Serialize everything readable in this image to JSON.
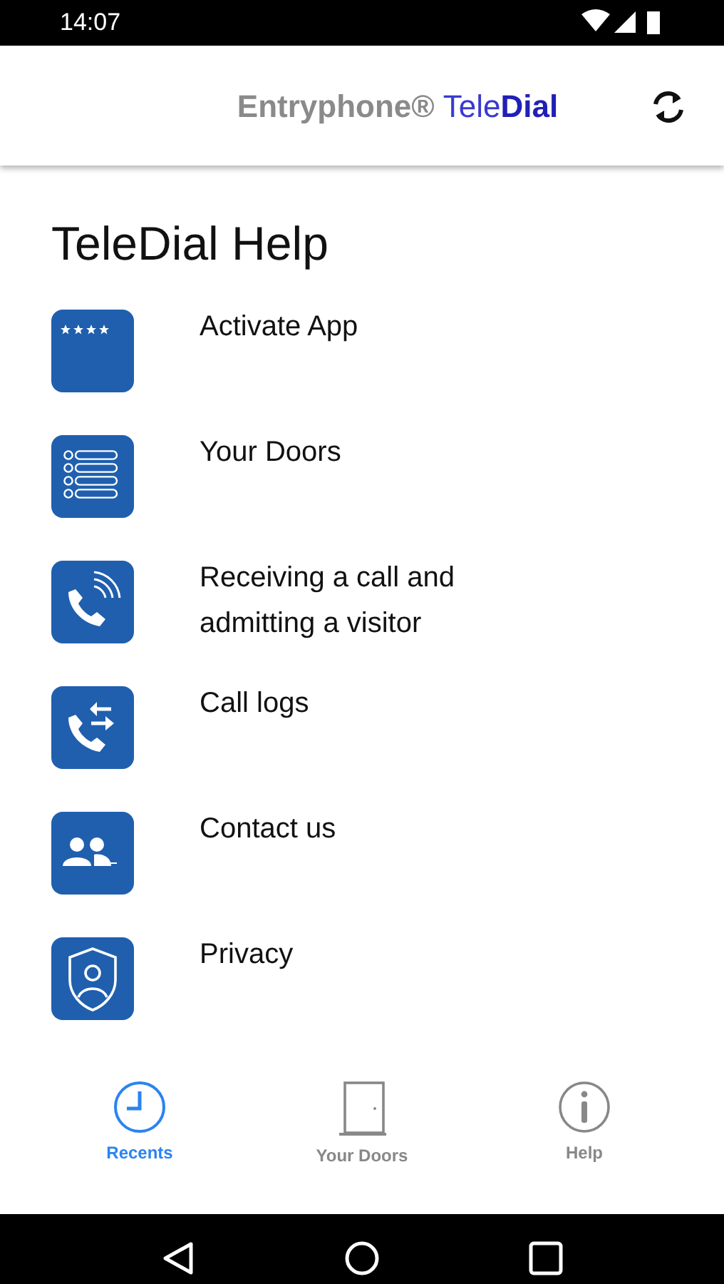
{
  "status_bar": {
    "time": "14:07"
  },
  "header": {
    "brand": "Entryphone®",
    "product": "Tele**Dial**"
  },
  "page": {
    "title": "TeleDial Help"
  },
  "help_items": [
    {
      "kind": "pin",
      "label": "Activate App"
    },
    {
      "kind": "list",
      "label": "Your Doors"
    },
    {
      "kind": "ringing",
      "label": "Receiving a call and admitting a visitor"
    },
    {
      "kind": "calllog",
      "label": "Call logs"
    },
    {
      "kind": "contact",
      "label": "Contact us"
    },
    {
      "kind": "privacy",
      "label": "Privacy"
    }
  ],
  "tabs": [
    {
      "kind": "clock",
      "label": "Recents",
      "selected": true
    },
    {
      "kind": "door",
      "label": "Your Doors",
      "selected": false
    },
    {
      "kind": "info",
      "label": "Help",
      "selected": false
    }
  ]
}
